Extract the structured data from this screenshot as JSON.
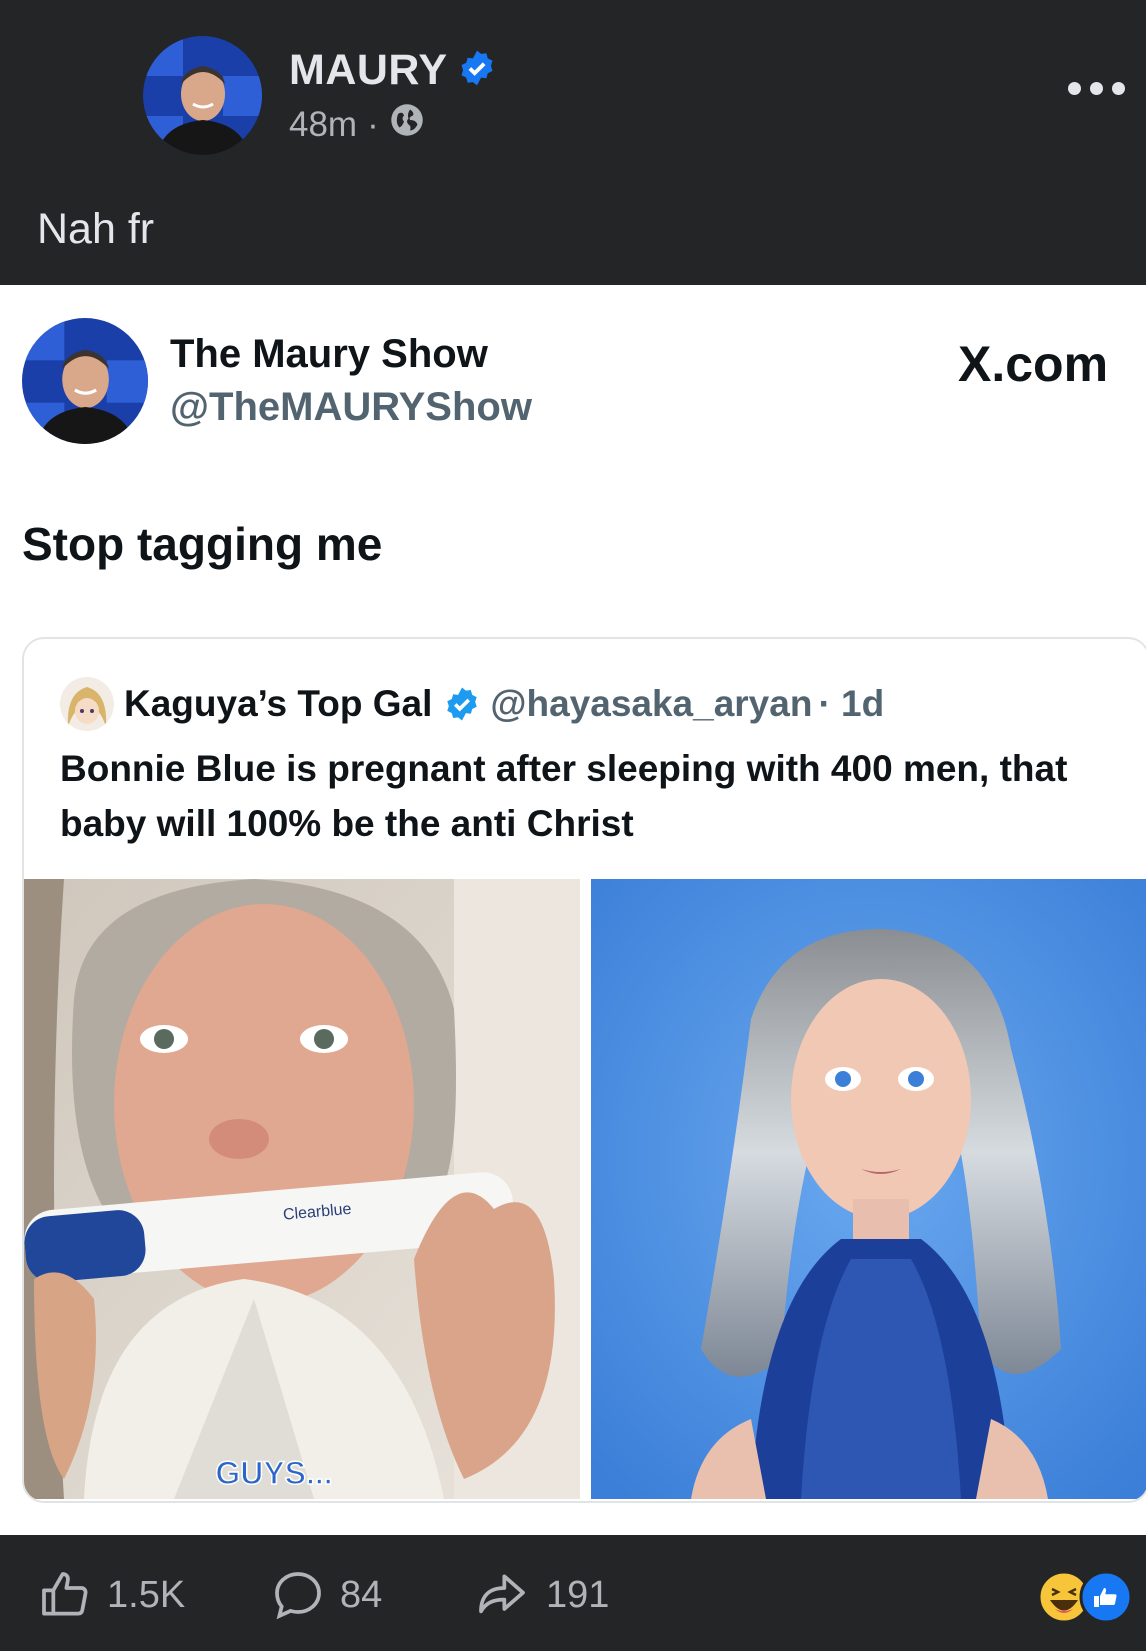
{
  "post": {
    "author": "MAURY",
    "time": "48m",
    "separator": "·",
    "caption": "Nah fr"
  },
  "embed": {
    "name": "The Maury Show",
    "handle": "@TheMAURYShow",
    "source": "X.com",
    "text": "Stop tagging me",
    "quoted": {
      "name": "Kaguya’s Top Gal",
      "handle": "@hayasaka_aryan",
      "time": "· 1d",
      "text": "Bonnie Blue is pregnant after sleeping with 400 men, that baby will 100% be the anti Christ",
      "image_caption": "GUYS...",
      "test_brand": "Clearblue"
    }
  },
  "footer": {
    "likes": "1.5K",
    "comments": "84",
    "shares": "191"
  },
  "colors": {
    "background": "#242526",
    "verified": "#1877f2",
    "text_light": "#e4e6eb",
    "text_muted": "#b0b3b8"
  }
}
